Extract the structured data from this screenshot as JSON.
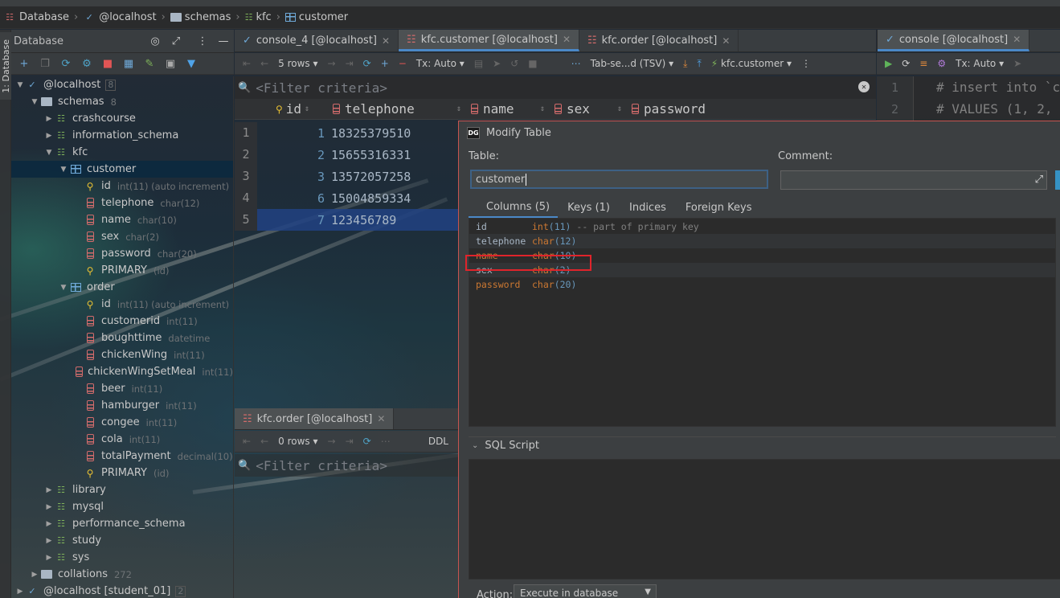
{
  "breadcrumb": [
    {
      "icon": "database-icon",
      "label": "Database"
    },
    {
      "icon": "datasource-icon",
      "label": "@localhost"
    },
    {
      "icon": "folder-icon",
      "label": "schemas"
    },
    {
      "icon": "schema-icon",
      "label": "kfc"
    },
    {
      "icon": "table-icon",
      "label": "customer"
    }
  ],
  "side_stripe": {
    "label": "1: Database"
  },
  "db_panel": {
    "title": "Database",
    "tree": [
      {
        "level": 0,
        "arrow": "down",
        "icon": "datasource",
        "label": "@localhost",
        "count": "8"
      },
      {
        "level": 1,
        "arrow": "down",
        "icon": "folder",
        "label": "schemas",
        "meta": "8"
      },
      {
        "level": 2,
        "arrow": "right",
        "icon": "schema",
        "label": "crashcourse"
      },
      {
        "level": 2,
        "arrow": "right",
        "icon": "schema",
        "label": "information_schema"
      },
      {
        "level": 2,
        "arrow": "down",
        "icon": "schema",
        "label": "kfc"
      },
      {
        "level": 3,
        "arrow": "down",
        "icon": "table",
        "label": "customer",
        "selected": true
      },
      {
        "level": 4,
        "icon": "key",
        "label": "id",
        "meta": "int(11) (auto increment)"
      },
      {
        "level": 4,
        "icon": "column",
        "label": "telephone",
        "meta": "char(12)"
      },
      {
        "level": 4,
        "icon": "column",
        "label": "name",
        "meta": "char(10)"
      },
      {
        "level": 4,
        "icon": "column",
        "label": "sex",
        "meta": "char(2)"
      },
      {
        "level": 4,
        "icon": "column",
        "label": "password",
        "meta": "char(20)"
      },
      {
        "level": 4,
        "icon": "key",
        "label": "PRIMARY",
        "meta": "(id)"
      },
      {
        "level": 3,
        "arrow": "down",
        "icon": "table",
        "label": "order"
      },
      {
        "level": 4,
        "icon": "key",
        "label": "id",
        "meta": "int(11) (auto increment)"
      },
      {
        "level": 4,
        "icon": "column",
        "label": "customerid",
        "meta": "int(11)"
      },
      {
        "level": 4,
        "icon": "column",
        "label": "boughttime",
        "meta": "datetime"
      },
      {
        "level": 4,
        "icon": "column",
        "label": "chickenWing",
        "meta": "int(11)"
      },
      {
        "level": 4,
        "icon": "column",
        "label": "chickenWingSetMeal",
        "meta": "int(11)"
      },
      {
        "level": 4,
        "icon": "column",
        "label": "beer",
        "meta": "int(11)"
      },
      {
        "level": 4,
        "icon": "column",
        "label": "hamburger",
        "meta": "int(11)"
      },
      {
        "level": 4,
        "icon": "column",
        "label": "congee",
        "meta": "int(11)"
      },
      {
        "level": 4,
        "icon": "column",
        "label": "cola",
        "meta": "int(11)"
      },
      {
        "level": 4,
        "icon": "column",
        "label": "totalPayment",
        "meta": "decimal(10)"
      },
      {
        "level": 4,
        "icon": "key",
        "label": "PRIMARY",
        "meta": "(id)"
      },
      {
        "level": 2,
        "arrow": "right",
        "icon": "schema",
        "label": "library"
      },
      {
        "level": 2,
        "arrow": "right",
        "icon": "schema",
        "label": "mysql"
      },
      {
        "level": 2,
        "arrow": "right",
        "icon": "schema",
        "label": "performance_schema"
      },
      {
        "level": 2,
        "arrow": "right",
        "icon": "schema",
        "label": "study"
      },
      {
        "level": 2,
        "arrow": "right",
        "icon": "schema",
        "label": "sys"
      },
      {
        "level": 1,
        "arrow": "right",
        "icon": "folder",
        "label": "collations",
        "meta": "272"
      },
      {
        "level": 0,
        "arrow": "right",
        "icon": "datasource",
        "label": "@localhost [student_01]",
        "count": "2"
      }
    ]
  },
  "editor_tabs": [
    {
      "label": "console_4 [@localhost]",
      "icon": "console-icon",
      "active": false
    },
    {
      "label": "kfc.customer [@localhost]",
      "icon": "table-icon",
      "active": true
    },
    {
      "label": "kfc.order [@localhost]",
      "icon": "table-icon",
      "active": false
    }
  ],
  "editor_toolbar": {
    "rows": "5 rows",
    "tx": "Tx: Auto",
    "format": "Tab-se...d (TSV)",
    "target": "kfc.customer"
  },
  "filter_placeholder": "<Filter criteria>",
  "grid": {
    "columns": [
      "id",
      "telephone",
      "name",
      "sex",
      "password"
    ],
    "rows": [
      {
        "n": "1",
        "id": "1",
        "telephone": "18325379510"
      },
      {
        "n": "2",
        "id": "2",
        "telephone": "15655316331"
      },
      {
        "n": "3",
        "id": "3",
        "telephone": "13572057258"
      },
      {
        "n": "4",
        "id": "6",
        "telephone": "15004859334"
      },
      {
        "n": "5",
        "id": "7",
        "telephone": "123456789",
        "selected": true
      }
    ]
  },
  "bottom_panel": {
    "tab": "kfc.order [@localhost]",
    "rows": "0 rows",
    "ddl": "DDL",
    "filter": "<Filter criteria>"
  },
  "console": {
    "tab": "console [@localhost]",
    "tx": "Tx: Auto",
    "lines": [
      {
        "n": "1",
        "text": "# insert into `c"
      },
      {
        "n": "2",
        "text": "# VALUES (1, 2,"
      }
    ]
  },
  "modal": {
    "title": "Modify Table",
    "table_label": "Table:",
    "table_value": "customer",
    "comment_label": "Comment:",
    "tabs": [
      "Columns (5)",
      "Keys (1)",
      "Indices",
      "Foreign Keys"
    ],
    "columns": [
      {
        "name": "id",
        "type": "int",
        "arg": "(11)",
        "comment": " -- part of primary key"
      },
      {
        "name": "telephone",
        "type": "char",
        "arg": "(12)"
      },
      {
        "name": "name",
        "type": "char",
        "arg": "(10)",
        "highlighted": true
      },
      {
        "name": "sex",
        "type": "char",
        "arg": "(2)"
      },
      {
        "name": "password",
        "type": "char",
        "arg": "(20)"
      }
    ],
    "sql_script_label": "SQL Script",
    "action_label": "Action:",
    "action_value": "Execute in database"
  },
  "colors": {
    "accent": "#4a88c7",
    "highlight_box": "#e0242b",
    "selection": "#0d293e",
    "column_icon": "#d26b6b",
    "key_icon": "#e8c032"
  }
}
